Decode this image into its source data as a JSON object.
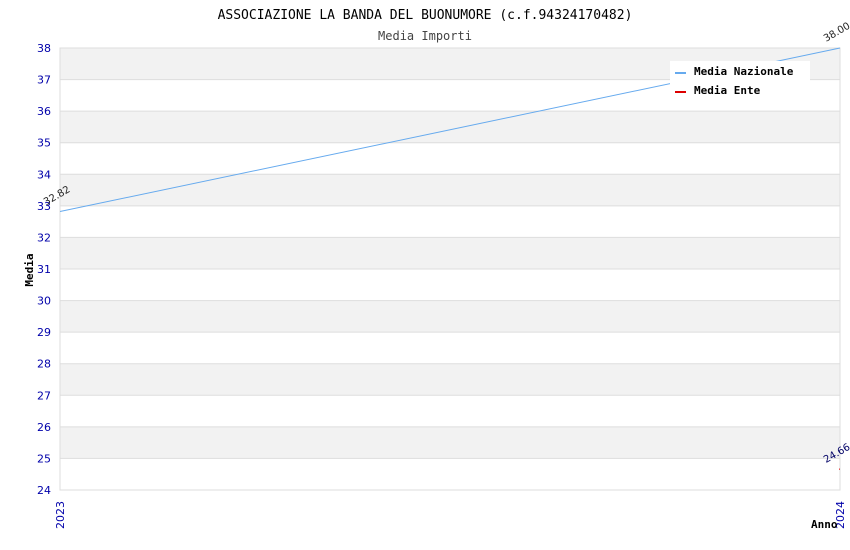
{
  "chart_data": {
    "type": "line",
    "title": "ASSOCIAZIONE LA BANDA DEL BUONUMORE (c.f.94324170482)",
    "subtitle": "Media Importi",
    "xlabel": "Anno",
    "ylabel": "Media",
    "x": [
      "2023",
      "2024"
    ],
    "ylim": [
      24,
      38
    ],
    "yticks": [
      24,
      25,
      26,
      27,
      28,
      29,
      30,
      31,
      32,
      33,
      34,
      35,
      36,
      37,
      38
    ],
    "grid": true,
    "legend_position": "top-right",
    "series": [
      {
        "name": "Media Nazionale",
        "color": "#66aaee",
        "values": [
          32.82,
          38.0
        ],
        "labels": [
          "32.82",
          "38.00"
        ]
      },
      {
        "name": "Media Ente",
        "color": "#dd0000",
        "values": [
          null,
          24.66
        ],
        "labels": [
          "",
          "24.66"
        ]
      }
    ]
  },
  "colors": {
    "band_alt": "#f2f2f2",
    "band": "#ffffff",
    "grid_line": "#dddddd",
    "tick_text": "#0000aa",
    "label_dark": "#000066"
  }
}
